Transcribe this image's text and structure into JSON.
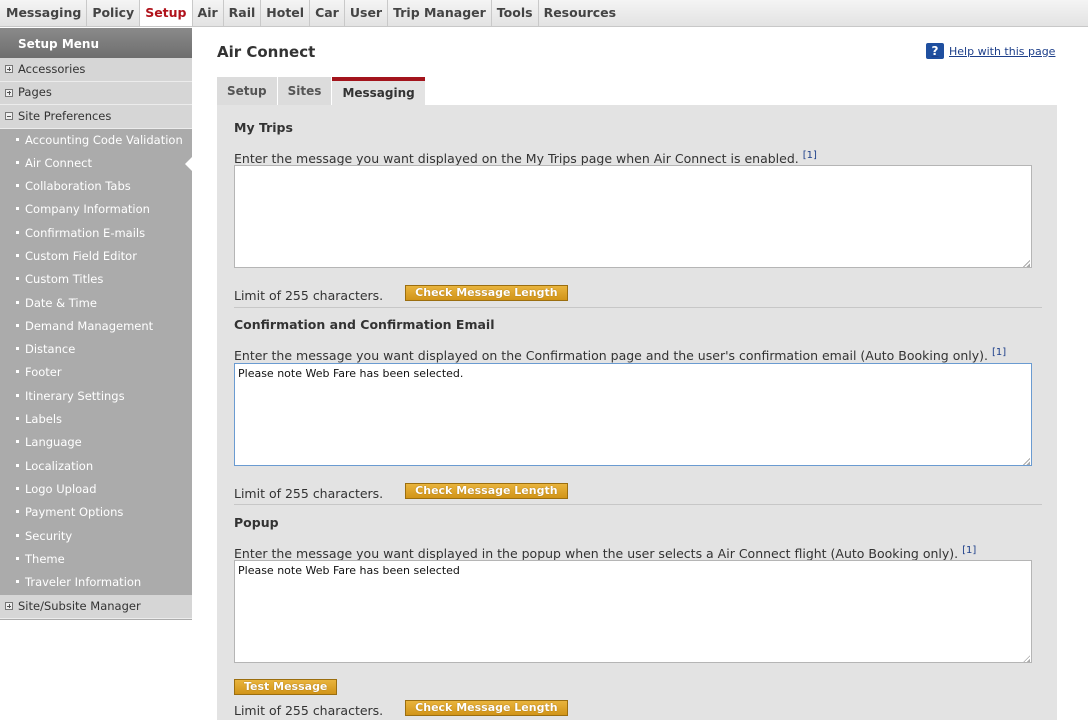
{
  "topnav": {
    "items": [
      "Messaging",
      "Policy",
      "Setup",
      "Air",
      "Rail",
      "Hotel",
      "Car",
      "User",
      "Trip Manager",
      "Tools",
      "Resources"
    ],
    "active": "Setup"
  },
  "sidebar": {
    "header": "Setup Menu",
    "categories": [
      "Accessories",
      "Pages",
      "Site Preferences"
    ],
    "items": [
      "Accounting Code Validation",
      "Air Connect",
      "Collaboration Tabs",
      "Company Information",
      "Confirmation E-mails",
      "Custom Field Editor",
      "Custom Titles",
      "Date & Time",
      "Demand Management",
      "Distance",
      "Footer",
      "Itinerary Settings",
      "Labels",
      "Language",
      "Localization",
      "Logo Upload",
      "Payment Options",
      "Security",
      "Theme",
      "Traveler Information"
    ],
    "bottom_category": "Site/Subsite Manager"
  },
  "page": {
    "title": "Air Connect",
    "help": "Help with this page",
    "help_icon": "?"
  },
  "tabs": [
    "Setup",
    "Sites",
    "Messaging"
  ],
  "sections": {
    "mytrips": {
      "title": "My Trips",
      "desc": "Enter the message you want displayed on the My Trips page when Air Connect is enabled.",
      "ref": "[1]",
      "value": "",
      "limit": "Limit of 255 characters.",
      "button": "Check Message Length"
    },
    "confirmation": {
      "title": "Confirmation and Confirmation Email",
      "desc": "Enter the message you want displayed on the Confirmation page and the user's confirmation email (Auto Booking only).",
      "ref": "[1]",
      "value": "Please note Web Fare has been selected.",
      "limit": "Limit of 255 characters.",
      "button": "Check Message Length"
    },
    "popup": {
      "title": "Popup",
      "desc": "Enter the message you want displayed in the popup when the user selects a Air Connect flight (Auto Booking only).",
      "ref": "[1]",
      "value": "Please note Web Fare has been selected",
      "test_button": "Test Message",
      "limit": "Limit of 255 characters.",
      "button": "Check Message Length"
    }
  }
}
